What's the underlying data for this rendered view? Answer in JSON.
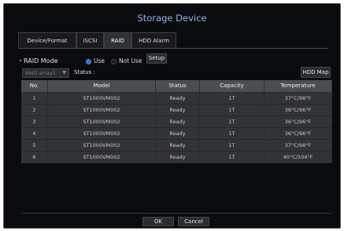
{
  "window": {
    "title": "Storage Device"
  },
  "tabs": [
    {
      "label": "Device/Format",
      "active": false
    },
    {
      "label": "iSCSI",
      "active": false
    },
    {
      "label": "RAID",
      "active": true
    },
    {
      "label": "HDD Alarm",
      "active": false
    }
  ],
  "raid_mode": {
    "label": "RAID Mode",
    "use_label": "Use",
    "not_use_label": "Not Use",
    "selected": "Use",
    "setup_label": "Setup"
  },
  "raid_array": {
    "select_value": "RAID array1",
    "status_label": "Status :",
    "hdd_map_label": "HDD Map"
  },
  "table": {
    "headers": [
      "No.",
      "Model",
      "Status",
      "Capacity",
      "Temperature"
    ],
    "rows": [
      [
        "1",
        "ST1000VM002",
        "Ready",
        "1T",
        "37°C/98°F"
      ],
      [
        "2",
        "ST1000VM002",
        "Ready",
        "1T",
        "36°C/96°F"
      ],
      [
        "3",
        "ST1000VM002",
        "Ready",
        "1T",
        "36°C/96°F"
      ],
      [
        "4",
        "ST1000VM002",
        "Ready",
        "1T",
        "36°C/96°F"
      ],
      [
        "5",
        "ST1000VM002",
        "Ready",
        "1T",
        "37°C/98°F"
      ],
      [
        "6",
        "ST1000VM002",
        "Ready",
        "1T",
        "40°C/104°F"
      ]
    ]
  },
  "footer": {
    "ok_label": "OK",
    "cancel_label": "Cancel"
  },
  "colors": {
    "title": "#8fb6ea",
    "background": "#0a0b0d",
    "accent": "#2e6fd6"
  }
}
